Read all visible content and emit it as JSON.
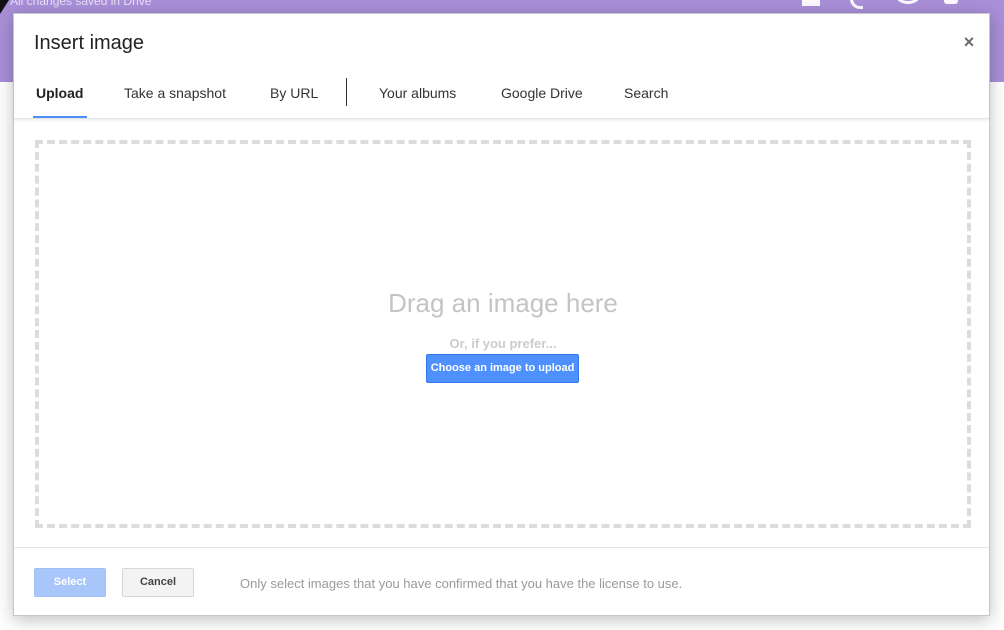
{
  "app_header": {
    "status_text": "All changes saved in Drive",
    "color": "#a98fd8",
    "icons": [
      "home-icon",
      "notifications-icon",
      "help-icon",
      "settings-icon"
    ]
  },
  "dialog": {
    "title": "Insert image",
    "close_label": "×",
    "tabs": [
      {
        "label": "Upload",
        "active": true
      },
      {
        "label": "Take a snapshot",
        "active": false
      },
      {
        "label": "By URL",
        "active": false
      },
      {
        "label": "Your albums",
        "active": false
      },
      {
        "label": "Google Drive",
        "active": false
      },
      {
        "label": "Search",
        "active": false
      }
    ],
    "dropzone": {
      "heading": "Drag an image here",
      "or_text": "Or, if you prefer...",
      "choose_button": "Choose an image to upload"
    },
    "footer": {
      "select_label": "Select",
      "cancel_label": "Cancel",
      "note": "Only select images that you have confirmed that you have the license to use."
    }
  },
  "colors": {
    "accent": "#4d90fe",
    "select_disabled": "#a8c6fa"
  }
}
